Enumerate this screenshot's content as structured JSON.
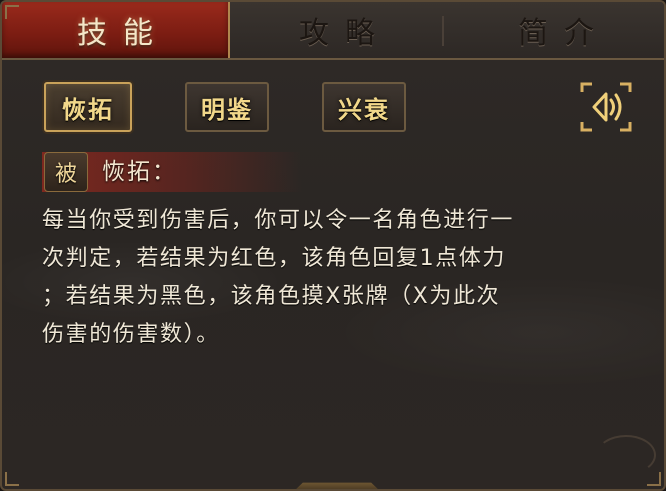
{
  "tabs": [
    {
      "label": "技能",
      "active": true
    },
    {
      "label": "攻略",
      "active": false
    },
    {
      "label": "简介",
      "active": false
    }
  ],
  "skills": [
    {
      "label": "恢拓",
      "selected": true
    },
    {
      "label": "明鉴",
      "selected": false
    },
    {
      "label": "兴衰",
      "selected": false
    }
  ],
  "sound_icon": "speaker-icon",
  "detail": {
    "badge": "被",
    "title": "恢拓：",
    "description": "每当你受到伤害后，你可以令一名角色进行一\n次判定，若结果为红色，该角色回复1点体力\n；若结果为黑色，该角色摸X张牌（X为此次\n伤害的伤害数）。"
  },
  "colors": {
    "active_tab": "#7a1c12",
    "gold_text": "#f2d88a",
    "body_text": "#efe7d6",
    "frame": "#6c5a40"
  }
}
